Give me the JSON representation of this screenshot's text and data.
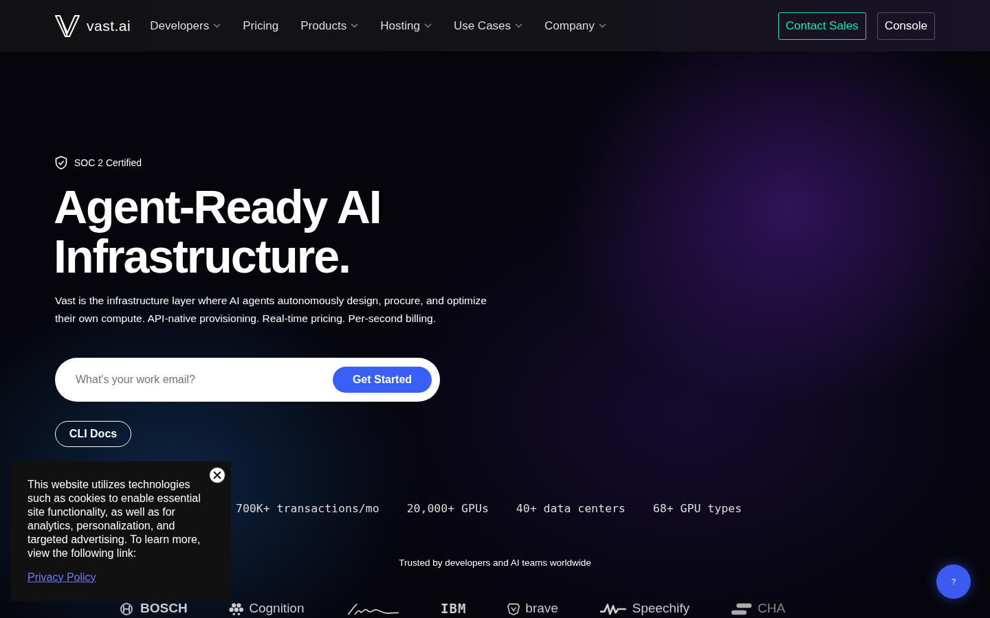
{
  "nav": {
    "brand": "vast.ai",
    "items": [
      {
        "label": "Developers",
        "dropdown": true
      },
      {
        "label": "Pricing",
        "dropdown": false
      },
      {
        "label": "Products",
        "dropdown": true
      },
      {
        "label": "Hosting",
        "dropdown": true
      },
      {
        "label": "Use Cases",
        "dropdown": true
      },
      {
        "label": "Company",
        "dropdown": true
      }
    ],
    "buttons": [
      {
        "label": "Contact Sales",
        "kind": "accent"
      },
      {
        "label": "Console",
        "kind": "plain"
      }
    ]
  },
  "hero": {
    "badge": "SOC 2 Certified",
    "title_lines": [
      "Agent-Ready AI",
      "Infrastructure."
    ],
    "description": "Vast is the infrastructure layer where AI agents autonomously design, procure, and optimize their own compute. API-native provisioning. Real-time pricing. Per-second billing.",
    "email": {
      "placeholder": "What's your work email?",
      "button": "Get Started"
    },
    "cli_button": "CLI Docs"
  },
  "stats": [
    "700K+ transactions/mo",
    "20,000+ GPUs",
    "40+ data centers",
    "68+ GPU types"
  ],
  "trusted": {
    "caption": "Trusted by developers and AI teams worldwide",
    "logos": [
      {
        "kind": "bosch",
        "text": "BOSCH"
      },
      {
        "kind": "cognition",
        "text": "Cognition"
      },
      {
        "kind": "script"
      },
      {
        "kind": "ibm",
        "text": "IBM"
      },
      {
        "kind": "brave",
        "text": "brave"
      },
      {
        "kind": "speechify",
        "text": "Speechify"
      },
      {
        "kind": "chai",
        "text": "CHA"
      }
    ]
  },
  "cookie": {
    "text": "This website utilizes technologies such as cookies to enable essential site functionality, as well as for analytics, personalization, and targeted advertising. To learn more, view the following link:",
    "link": "Privacy Policy"
  },
  "help_button": "?"
}
